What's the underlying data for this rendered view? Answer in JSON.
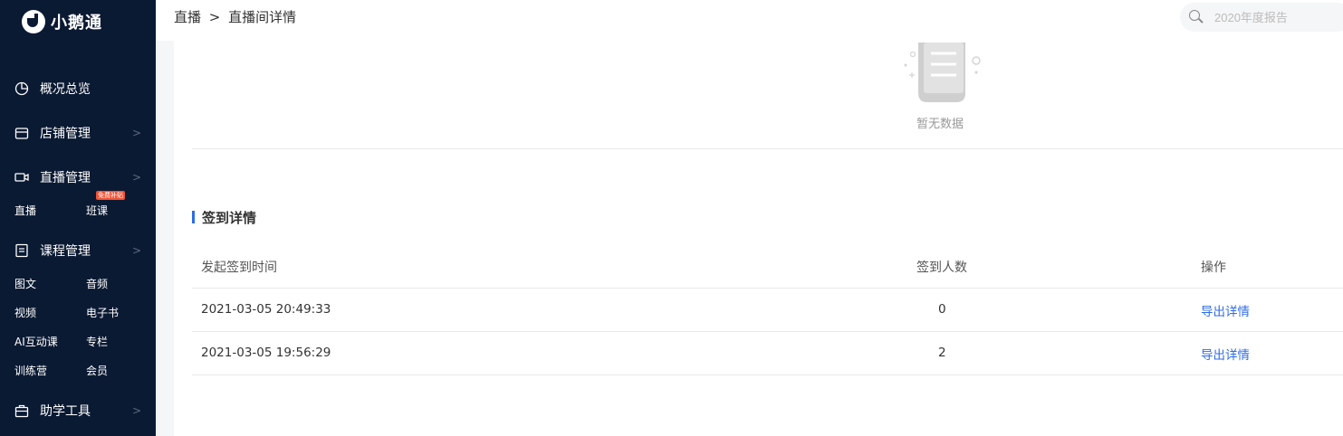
{
  "app": {
    "name": "小鹅通"
  },
  "sidebar": {
    "items": [
      {
        "label": "概况总览",
        "icon": "pie-chart-icon"
      },
      {
        "label": "店铺管理",
        "icon": "store-icon"
      },
      {
        "label": "直播管理",
        "icon": "video-icon"
      },
      {
        "label": "课程管理",
        "icon": "document-icon"
      },
      {
        "label": "助学工具",
        "icon": "toolbox-icon"
      }
    ],
    "live_sub": [
      "直播",
      "班课"
    ],
    "badge": "免费补贴",
    "course_sub": [
      "图文",
      "音频",
      "视频",
      "电子书",
      "AI互动课",
      "专栏",
      "训练营",
      "会员"
    ]
  },
  "header": {
    "breadcrumb": [
      "直播",
      ">",
      "直播间详情"
    ],
    "search_placeholder": "2020年度报告"
  },
  "empty_state": {
    "text": "暂无数据"
  },
  "signin": {
    "title": "签到详情",
    "columns": [
      "发起签到时间",
      "签到人数",
      "操作"
    ],
    "rows": [
      {
        "time": "2021-03-05 20:49:33",
        "count": "0",
        "action": "导出详情"
      },
      {
        "time": "2021-03-05 19:56:29",
        "count": "2",
        "action": "导出详情"
      }
    ]
  }
}
